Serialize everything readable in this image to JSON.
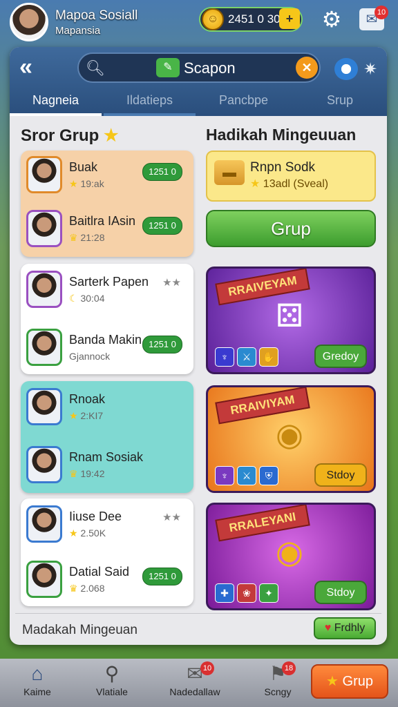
{
  "profile": {
    "name": "Mapoa Sosiall",
    "subtitle": "Mapansia"
  },
  "currency": {
    "value": "2451 0 30",
    "plus": "+"
  },
  "mail_badge": "10",
  "search": {
    "text": "Scapon"
  },
  "tabs": [
    "Nagneia",
    "Ildatieps",
    "Pancbpe",
    "Srup"
  ],
  "left_section": {
    "title": "Sror Grup"
  },
  "right_section": {
    "title": "Hadikah Mingeuuan"
  },
  "groups": [
    {
      "name": "Buak",
      "sub": "19:ak",
      "badge": "1251 0",
      "bg": "#f6d1a8",
      "avatar_border": "#e08a2a"
    },
    {
      "name": "Baitlra IAsin",
      "sub": "21:28",
      "badge": "1251 0",
      "bg": "#f6d1a8",
      "avatar_border": "#9a50c0"
    },
    {
      "name": "Sarterk Papen",
      "sub": "30:04",
      "stars": "★★",
      "bg": "#ffffff",
      "avatar_border": "#9a50c0"
    },
    {
      "name": "Banda Makin",
      "sub": "Gjannock",
      "badge": "1251 0",
      "bg": "#ffffff",
      "avatar_border": "#3aa040"
    },
    {
      "name": "Rnoak",
      "sub": "2:KI7",
      "bg": "#7fd9d2",
      "avatar_border": "#3a7ad0"
    },
    {
      "name": "Rnam Sosiak",
      "sub": "19:42",
      "bg": "#7fd9d2",
      "avatar_border": "#3a7ad0"
    },
    {
      "name": "Iiuse Dee",
      "sub": "2.50K",
      "stars": "★★",
      "bg": "#ffffff",
      "avatar_border": "#3a7ad0"
    },
    {
      "name": "Datial Said",
      "sub": "2.068",
      "badge": "1251 0",
      "bg": "#ffffff",
      "avatar_border": "#3aa040"
    }
  ],
  "gift": {
    "title": "Rnpn Sodk",
    "sub": "13adl (Sveal)",
    "button": "Grup"
  },
  "promos": [
    {
      "ribbon": "RRAIVEYAM",
      "button": "Gredoy",
      "bg": "#7a3ac0",
      "btn_color": "#4aa83a"
    },
    {
      "ribbon": "RRAIVIYAM",
      "button": "Stdoy",
      "bg": "#f08a1a",
      "btn_color": "#f0b21a"
    },
    {
      "ribbon": "RRALEYANI",
      "button": "Stdoy",
      "bg": "#9a2aa8",
      "btn_color": "#4aa83a"
    }
  ],
  "footer": {
    "text": "Madakah Mingeuan",
    "button": "Frdhly"
  },
  "bottom_nav": [
    {
      "label": "Kaime"
    },
    {
      "label": "Vlatiale"
    },
    {
      "label": "Nadedallaw",
      "badge": "10"
    },
    {
      "label": "Scngy",
      "badge": "18"
    }
  ],
  "bottom_action": "Grup"
}
